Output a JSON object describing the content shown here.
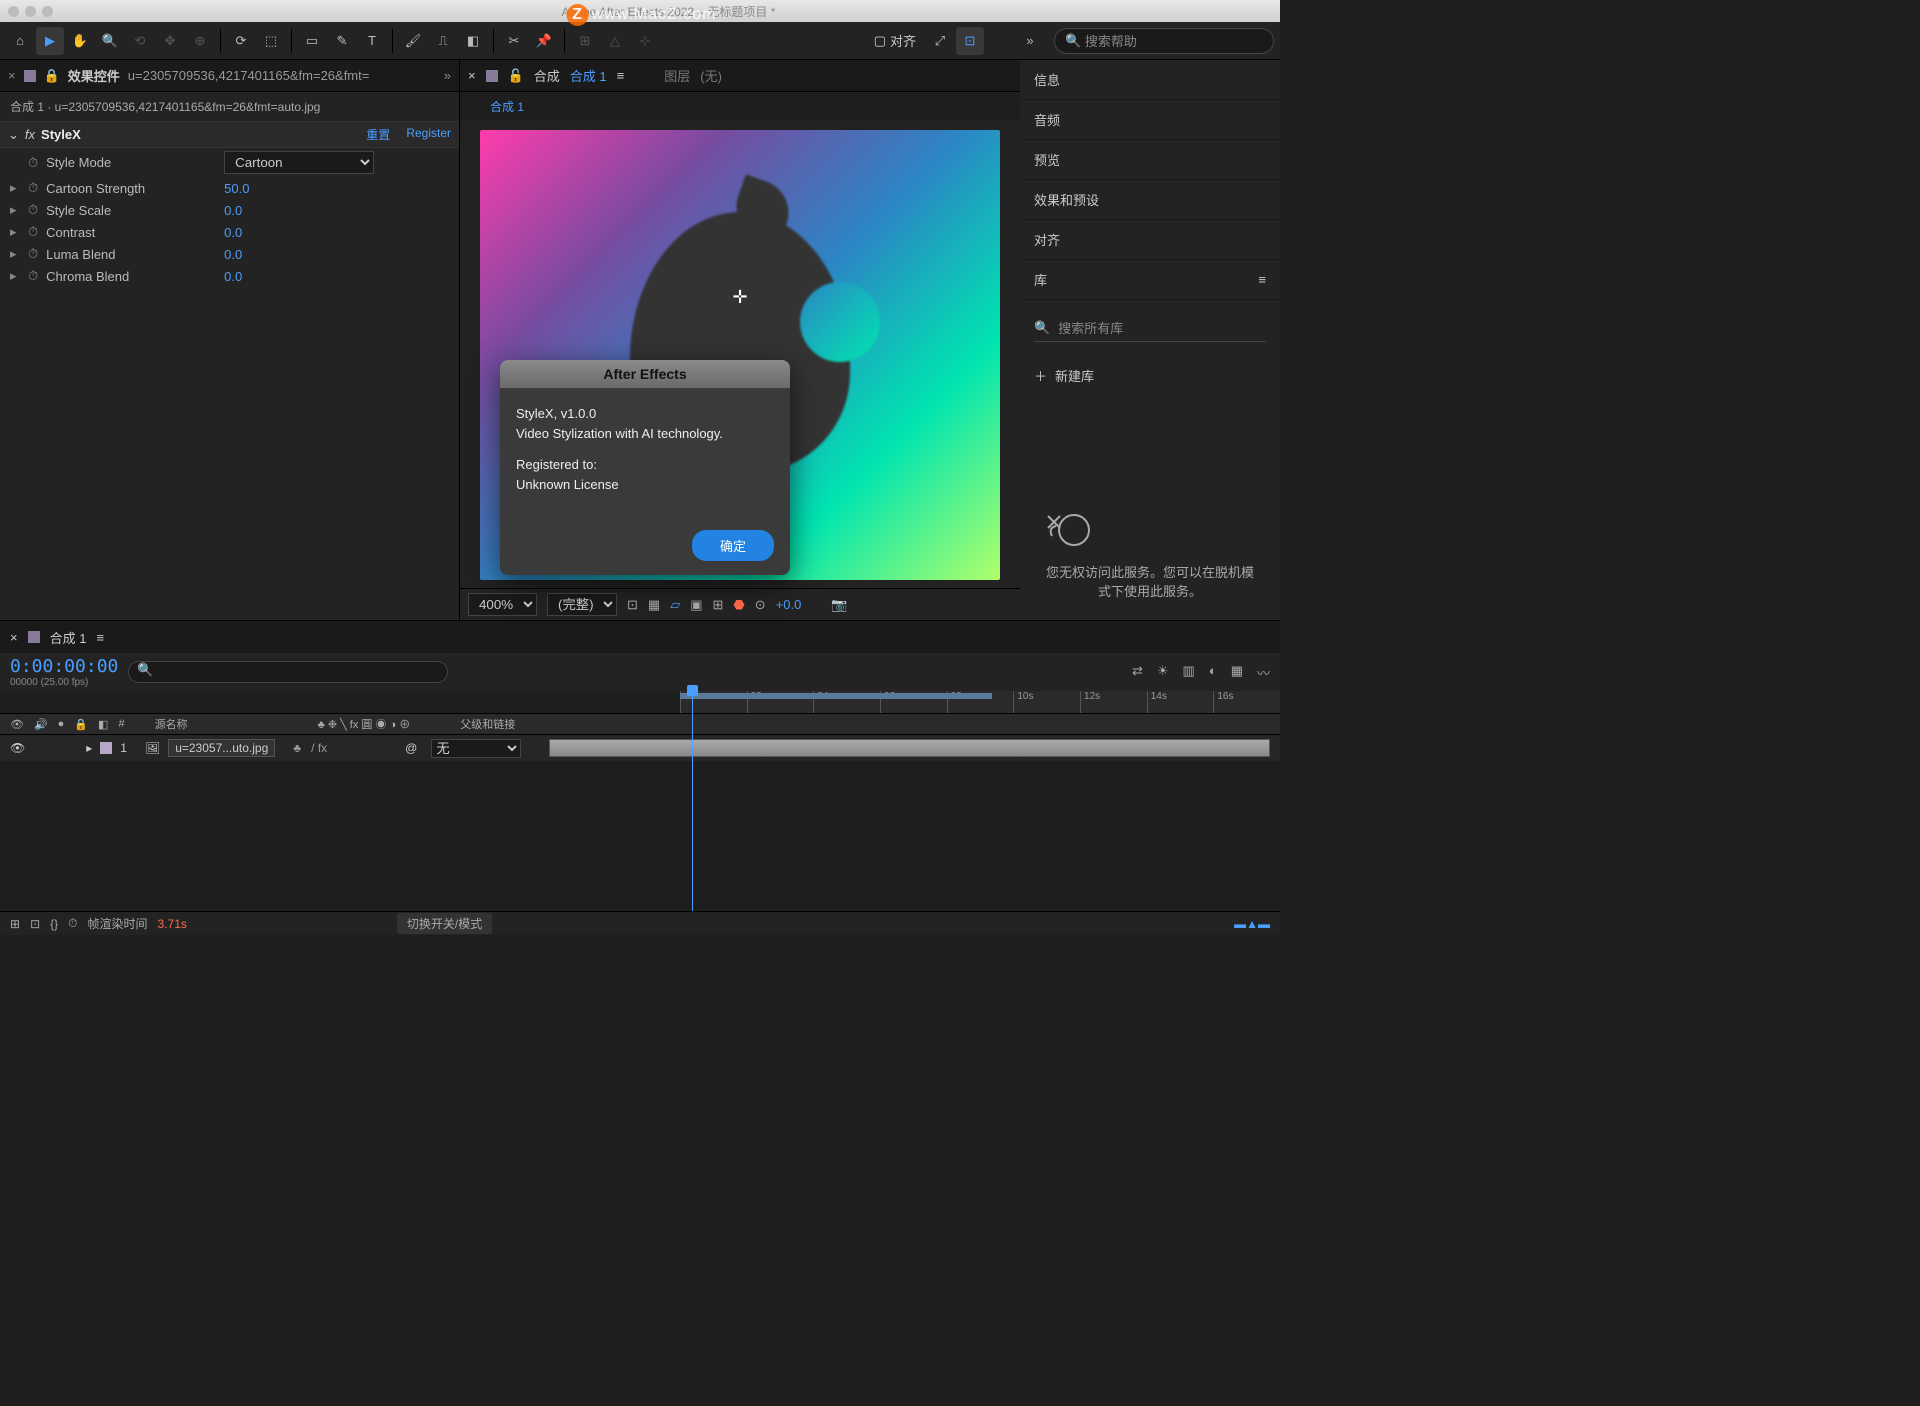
{
  "window": {
    "title": "Adobe After Effects 2022 – 无标题项目 *"
  },
  "watermark": "www.MacZ.com",
  "toolbar": {
    "align_label": "对齐",
    "search_placeholder": "搜索帮助"
  },
  "left": {
    "tab_label": "效果控件",
    "tab_file": "u=2305709536,4217401165&fm=26&fmt=",
    "breadcrumb": "合成 1 · u=2305709536,4217401165&fm=26&fmt=auto.jpg",
    "fx_name": "StyleX",
    "reset": "重置",
    "register": "Register",
    "props": {
      "style_mode": {
        "label": "Style Mode",
        "value": "Cartoon"
      },
      "cartoon_strength": {
        "label": "Cartoon Strength",
        "value": "50.0"
      },
      "style_scale": {
        "label": "Style Scale",
        "value": "0.0"
      },
      "contrast": {
        "label": "Contrast",
        "value": "0.0"
      },
      "luma_blend": {
        "label": "Luma Blend",
        "value": "0.0"
      },
      "chroma_blend": {
        "label": "Chroma Blend",
        "value": "0.0"
      }
    }
  },
  "center": {
    "tab_comp": "合成",
    "tab_comp_name": "合成 1",
    "tab_layer": "图层",
    "tab_layer_none": "(无)",
    "crumb": "合成 1",
    "zoom": "400%",
    "quality": "(完整)",
    "exposure": "+0.0"
  },
  "right": {
    "items": [
      "信息",
      "音频",
      "预览",
      "效果和预设",
      "对齐",
      "库"
    ],
    "lib_search_placeholder": "搜索所有库",
    "new_lib": "新建库",
    "msg_line1": "您无权访问此服务。您可以在脱机模",
    "msg_line2": "式下使用此服务。"
  },
  "dialog": {
    "title": "After Effects",
    "line1": "StyleX, v1.0.0",
    "line2": "Video Stylization with AI technology.",
    "line3": "Registered to:",
    "line4": " Unknown License",
    "ok": "确定"
  },
  "timeline": {
    "tab": "合成 1",
    "timecode": "0:00:00:00",
    "timecode_sub": "00000 (25.00 fps)",
    "ticks": [
      ":00s",
      "02s",
      "04s",
      "06s",
      "08s",
      "10s",
      "12s",
      "14s",
      "16s"
    ],
    "col_source": "源名称",
    "col_switches": "♣ ❉ ╲ fx 圓 ◉ ◑ ⊕",
    "col_parent": "父级和链接",
    "layer_num": "1",
    "layer_name": "u=23057...uto.jpg",
    "parent_none": "无",
    "render_label": "帧渲染时间",
    "render_time": "3.71s",
    "toggle_label": "切换开关/模式"
  }
}
